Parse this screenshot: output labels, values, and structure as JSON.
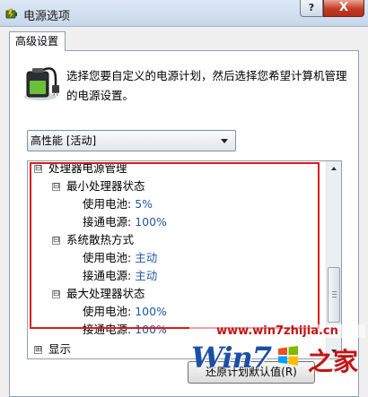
{
  "window": {
    "title": "电源选项",
    "help_label": "?",
    "close_label": "X"
  },
  "tab": {
    "label": "高级设置"
  },
  "description": "选择您要自定义的电源计划，然后选择您希望计算机管理的电源设置。",
  "plan_select": {
    "value": "高性能 [活动]"
  },
  "tree": {
    "processor_power": {
      "label": "处理器电源管理",
      "expander": "⊟"
    },
    "min_state": {
      "label": "最小处理器状态",
      "expander": "⊟",
      "on_battery_label": "使用电池:",
      "on_battery_value": "5%",
      "plugged_in_label": "接通电源:",
      "plugged_in_value": "100%"
    },
    "cooling_policy": {
      "label": "系统散热方式",
      "expander": "⊟",
      "on_battery_label": "使用电池:",
      "on_battery_value": "主动",
      "plugged_in_label": "接通电源:",
      "plugged_in_value": "主动"
    },
    "max_state": {
      "label": "最大处理器状态",
      "expander": "⊟",
      "on_battery_label": "使用电池:",
      "on_battery_value": "100%",
      "plugged_in_label": "接通电源:",
      "plugged_in_value": "100%"
    },
    "display": {
      "label": "显示",
      "expander": "⊞"
    }
  },
  "restore_button": {
    "label": "还原计划默认值(R)"
  },
  "watermark": {
    "url": "www.win7zhijia.cn",
    "brand": "Win7",
    "brand_cn": "之家"
  },
  "colors": {
    "highlight": "#d71c1c",
    "value_text": "#1f57a8",
    "close_button": "#c43b26"
  }
}
